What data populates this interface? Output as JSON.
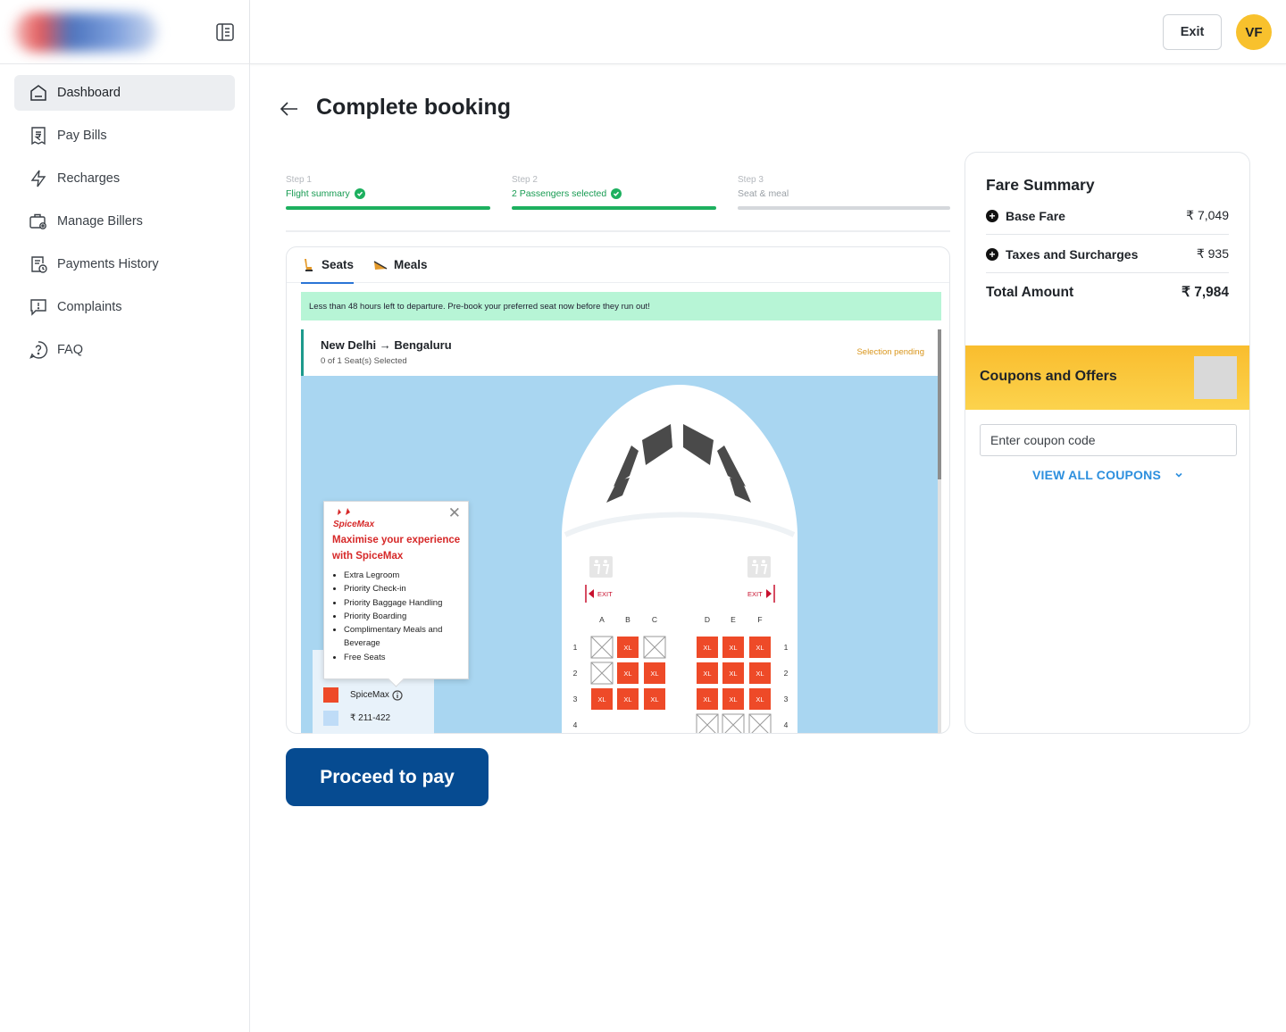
{
  "sidebar": {
    "items": [
      {
        "label": "Dashboard",
        "icon": "home-icon",
        "active": true
      },
      {
        "label": "Pay Bills",
        "icon": "rupee-receipt-icon"
      },
      {
        "label": "Recharges",
        "icon": "lightning-icon"
      },
      {
        "label": "Manage Billers",
        "icon": "briefcase-gear-icon"
      },
      {
        "label": "Payments History",
        "icon": "document-clock-icon"
      },
      {
        "label": "Complaints",
        "icon": "message-alert-icon"
      },
      {
        "label": "FAQ",
        "icon": "question-circle-icon"
      }
    ]
  },
  "topbar": {
    "exit_label": "Exit",
    "avatar_initials": "VF",
    "avatar_color": "#f8c12d"
  },
  "page": {
    "title": "Complete booking"
  },
  "stepper": {
    "steps": [
      {
        "num": "Step 1",
        "label": "Flight summary",
        "status": "done"
      },
      {
        "num": "Step 2",
        "label": "2 Passengers selected",
        "status": "done"
      },
      {
        "num": "Step 3",
        "label": "Seat & meal",
        "status": "pending"
      }
    ],
    "done_color": "#1db05f"
  },
  "seat_panel": {
    "tabs": [
      {
        "label": "Seats",
        "icon": "seat-icon",
        "active": true
      },
      {
        "label": "Meals",
        "icon": "meal-icon"
      }
    ],
    "notice": "Less than 48 hours left to departure. Pre-book your preferred seat now before they run out!",
    "route": "New Delhi → Bengaluru",
    "seats_selected": "0 of 1 Seat(s) Selected",
    "status": "Selection pending",
    "exit_label": "EXIT",
    "columns_left": [
      "A",
      "B",
      "C"
    ],
    "columns_right": [
      "D",
      "E",
      "F"
    ],
    "rows": [
      {
        "row": "1",
        "seats": [
          "blocked",
          "XL",
          "blocked",
          "XL",
          "XL",
          "XL"
        ]
      },
      {
        "row": "2",
        "seats": [
          "blocked",
          "XL",
          "XL",
          "XL",
          "XL",
          "XL"
        ]
      },
      {
        "row": "3",
        "seats": [
          "XL",
          "XL",
          "XL",
          "XL",
          "XL",
          "XL"
        ]
      },
      {
        "row": "4",
        "seats": [
          "",
          "",
          "",
          "blocked",
          "blocked",
          "blocked"
        ]
      }
    ],
    "xl_label": "XL",
    "seat_color": "#ee4a28"
  },
  "popup": {
    "brand": "SpiceMax",
    "heading": "Maximise your experience with SpiceMax",
    "benefits": [
      "Extra Legroom",
      "Priority Check-in",
      "Priority Baggage Handling",
      "Priority Boarding",
      "Complimentary Meals and Beverage",
      "Free Seats"
    ]
  },
  "legend": [
    {
      "label": "SpiceMax",
      "color": "#ee4a28"
    },
    {
      "label": "₹ 211-422",
      "color": "#bfdcf7"
    }
  ],
  "fare": {
    "title": "Fare Summary",
    "base_label": "Base Fare",
    "base_value": "₹ 7,049",
    "tax_label": "Taxes and Surcharges",
    "tax_value": "₹ 935",
    "total_label": "Total Amount",
    "total_value": "₹ 7,984"
  },
  "coupons": {
    "title": "Coupons and Offers",
    "input_placeholder": "Enter coupon code",
    "view_all": "VIEW ALL COUPONS"
  },
  "proceed_label": "Proceed to pay"
}
